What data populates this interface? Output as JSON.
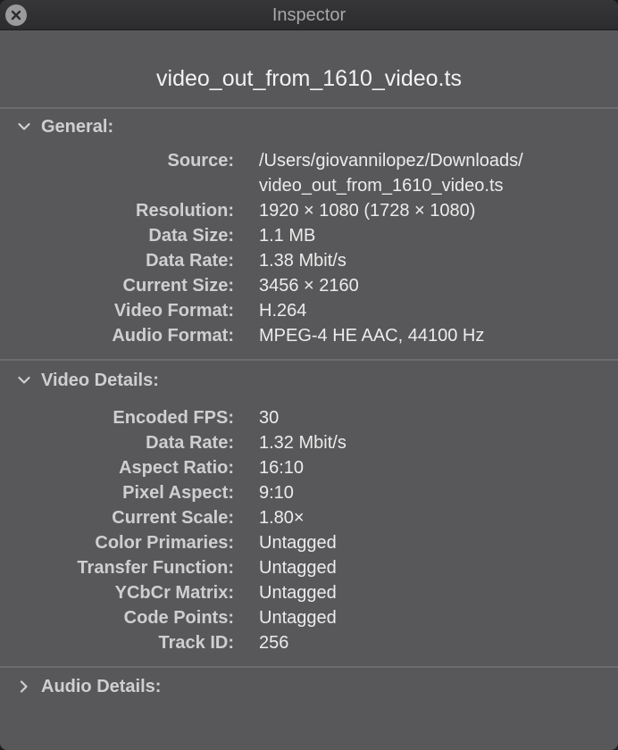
{
  "window": {
    "title": "Inspector",
    "close_icon": "close-icon"
  },
  "file": {
    "name": "video_out_from_1610_video.ts"
  },
  "general": {
    "header": "General:",
    "expanded": true,
    "source_label": "Source:",
    "source_line1": "/Users/giovannilopez/Downloads/",
    "source_line2": "video_out_from_1610_video.ts",
    "rows": [
      {
        "label": "Resolution:",
        "value": "1920 × 1080 (1728 × 1080)"
      },
      {
        "label": "Data Size:",
        "value": "1.1 MB"
      },
      {
        "label": "Data Rate:",
        "value": "1.38 Mbit/s"
      },
      {
        "label": "Current Size:",
        "value": "3456 × 2160"
      },
      {
        "label": "Video Format:",
        "value": "H.264"
      },
      {
        "label": "Audio Format:",
        "value": "MPEG-4 HE AAC, 44100 Hz"
      }
    ]
  },
  "video_details": {
    "header": "Video Details:",
    "expanded": true,
    "rows": [
      {
        "label": "Encoded FPS:",
        "value": "30"
      },
      {
        "label": "Data Rate:",
        "value": "1.32 Mbit/s"
      },
      {
        "label": "Aspect Ratio:",
        "value": "16:10"
      },
      {
        "label": "Pixel Aspect:",
        "value": "9:10"
      },
      {
        "label": "Current Scale:",
        "value": "1.80×"
      },
      {
        "label": "Color Primaries:",
        "value": "Untagged"
      },
      {
        "label": "Transfer Function:",
        "value": "Untagged"
      },
      {
        "label": "YCbCr Matrix:",
        "value": "Untagged"
      },
      {
        "label": "Code Points:",
        "value": "Untagged"
      },
      {
        "label": "Track ID:",
        "value": "256"
      }
    ]
  },
  "audio_details": {
    "header": "Audio Details:",
    "expanded": false
  },
  "colors": {
    "background": "#58585a",
    "titlebar": "#2c2c2e",
    "label": "#cfcfd1",
    "value": "#ececec"
  }
}
